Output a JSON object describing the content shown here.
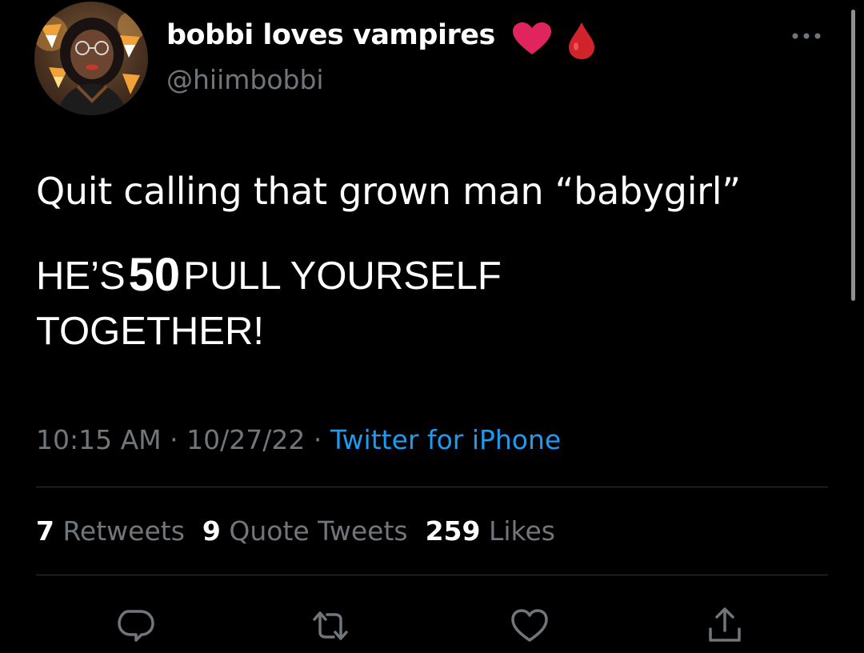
{
  "user": {
    "display_name": "bobbi loves vampires",
    "handle": "@hiimbobbi",
    "name_emoji": [
      "red-heart-emoji",
      "drop-of-blood-emoji"
    ]
  },
  "tweet": {
    "line1": "Quit calling that grown man “babygirl”",
    "line2_pre": "HE’S",
    "line2_big": "50",
    "line2_post": "PULL YOURSELF",
    "line3": "TOGETHER!"
  },
  "meta": {
    "time": "10:15 AM",
    "date": "10/27/22",
    "source": "Twitter for iPhone",
    "separator": "·"
  },
  "stats": {
    "retweets_count": "7",
    "retweets_label": "Retweets",
    "quotes_count": "9",
    "quotes_label": "Quote Tweets",
    "likes_count": "259",
    "likes_label": "Likes"
  },
  "actions": [
    "reply-icon",
    "retweet-icon",
    "like-icon",
    "share-icon"
  ],
  "colors": {
    "background": "#000000",
    "text": "#ffffff",
    "muted": "#71767b",
    "link": "#1d9bf0",
    "divider": "#2f3336",
    "heart": "#e0245e"
  }
}
